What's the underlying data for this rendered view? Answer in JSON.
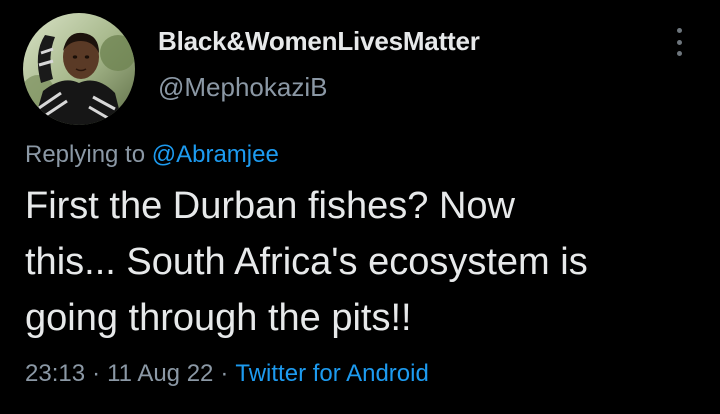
{
  "author": {
    "display_name": "Black&WomenLivesMatter",
    "handle": "@MephokaziB"
  },
  "reply": {
    "prefix": "Replying to ",
    "mention": "@Abramjee"
  },
  "tweet": {
    "lines": [
      "First the Durban fishes? Now",
      "this... South Africa's ecosystem is",
      "going through the pits!!"
    ]
  },
  "meta": {
    "time": "23:13",
    "separator": "·",
    "date": "11 Aug 22",
    "source": "Twitter for Android"
  },
  "icons": {
    "more": "more-options-icon"
  },
  "colors": {
    "background": "#000000",
    "text": "#e7e9ea",
    "secondary_text": "#8b98a5",
    "link": "#1d9bf0"
  }
}
